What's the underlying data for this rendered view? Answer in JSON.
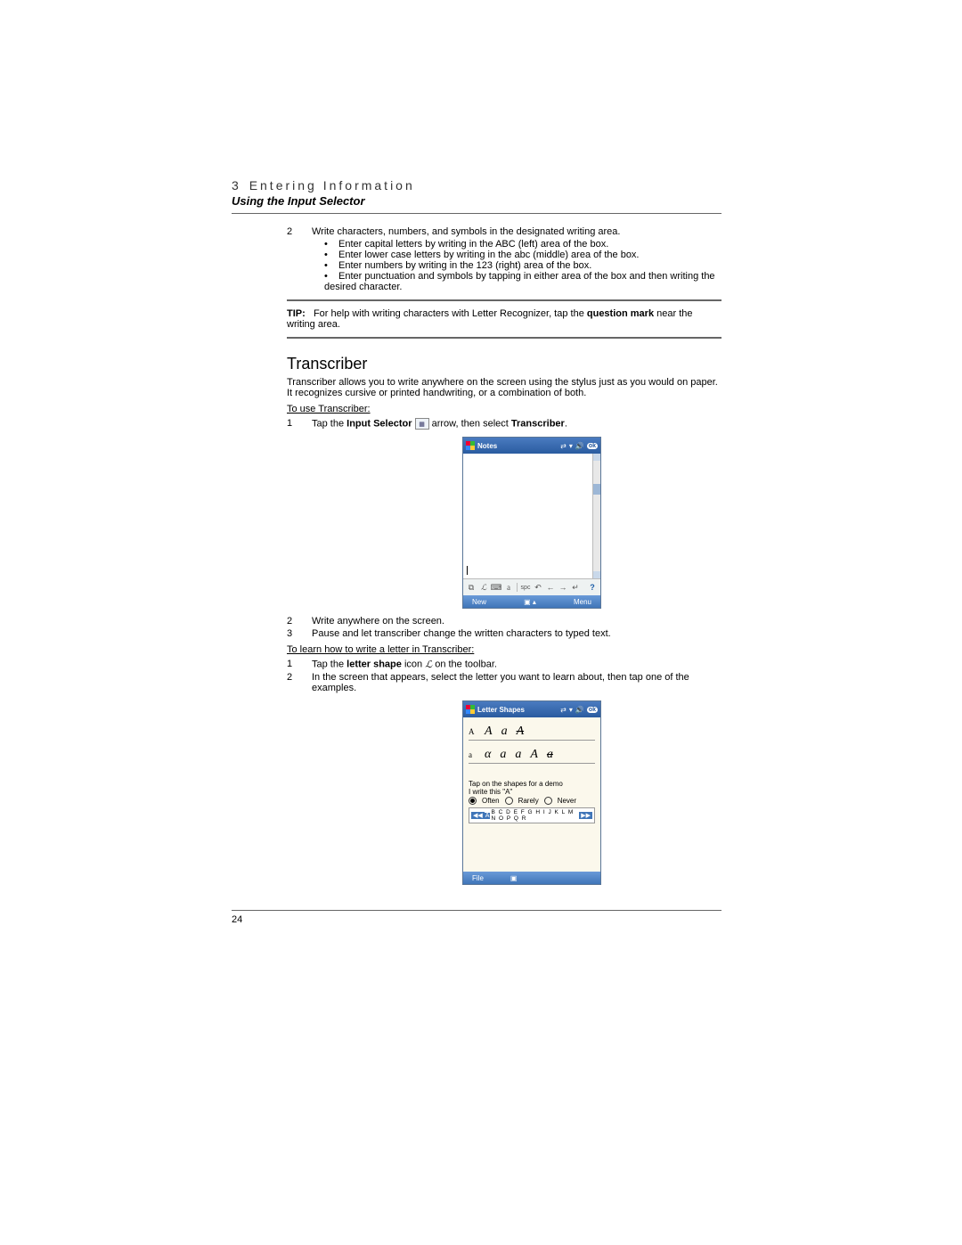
{
  "header": {
    "chapter_num": "3",
    "chapter_label": "Entering Information",
    "subtitle": "Using the Input Selector"
  },
  "step2": {
    "n": "2",
    "text": "Write characters, numbers, and symbols in the designated writing area.",
    "bullets": [
      "Enter capital letters by writing in the ABC (left) area of the box.",
      "Enter lower case letters by writing in the abc (middle) area of the box.",
      "Enter numbers by writing in the 123 (right) area of the box.",
      "Enter punctuation and symbols by tapping in either area of the box and then writing the desired character."
    ]
  },
  "tip": {
    "label": "TIP:",
    "before": "For help with writing characters with Letter Recognizer, tap the ",
    "bold": "question mark",
    "after": " near the writing area."
  },
  "transcriber": {
    "heading": "Transcriber",
    "intro": "Transcriber allows you to write anywhere on the screen using the stylus just as you would on paper. It recognizes cursive or printed handwriting, or a combination of both.",
    "to_use": "To use Transcriber:",
    "s1": {
      "n": "1",
      "a": "Tap the ",
      "b": "Input Selector",
      "c": " arrow, then select ",
      "d": "Transcriber",
      "e": "."
    },
    "s2": {
      "n": "2",
      "text": "Write anywhere on the screen."
    },
    "s3": {
      "n": "3",
      "text": "Pause and let transcriber change the written characters to typed text."
    },
    "to_learn": "To learn how to write a letter in Transcriber:",
    "l1": {
      "n": "1",
      "a": "Tap the ",
      "b": "letter shape",
      "c": " icon ",
      "d": " on the toolbar."
    },
    "l2": {
      "n": "2",
      "text": "In the screen that appears, select the letter you want to learn about, then tap one of the examples."
    }
  },
  "shot1": {
    "title": "Notes",
    "ok": "ok",
    "tb_a": "a",
    "tb_spc": "spc",
    "tb_left": "←",
    "tb_right": "→",
    "tb_enter": "↵",
    "tb_help": "?",
    "bb_new": "New",
    "bb_menu": "Menu"
  },
  "shot2": {
    "title": "Letter Shapes",
    "ok": "ok",
    "row1_lbl": "A",
    "row1": [
      "A",
      "a",
      "A"
    ],
    "row2_lbl": "a",
    "row2": [
      "α",
      "a",
      "a",
      "A",
      "a"
    ],
    "demo1": "Tap on the shapes for a demo",
    "demo2": "I write this \"A\"",
    "opt_often": "Often",
    "opt_rarely": "Rarely",
    "opt_never": "Never",
    "nav_prev": "◀◀",
    "nav_next": "▶▶",
    "sel_letter": "A",
    "alphabet": "B C D E F G H I J K L M N O P Q R",
    "bb_file": "File"
  },
  "page_num": "24"
}
